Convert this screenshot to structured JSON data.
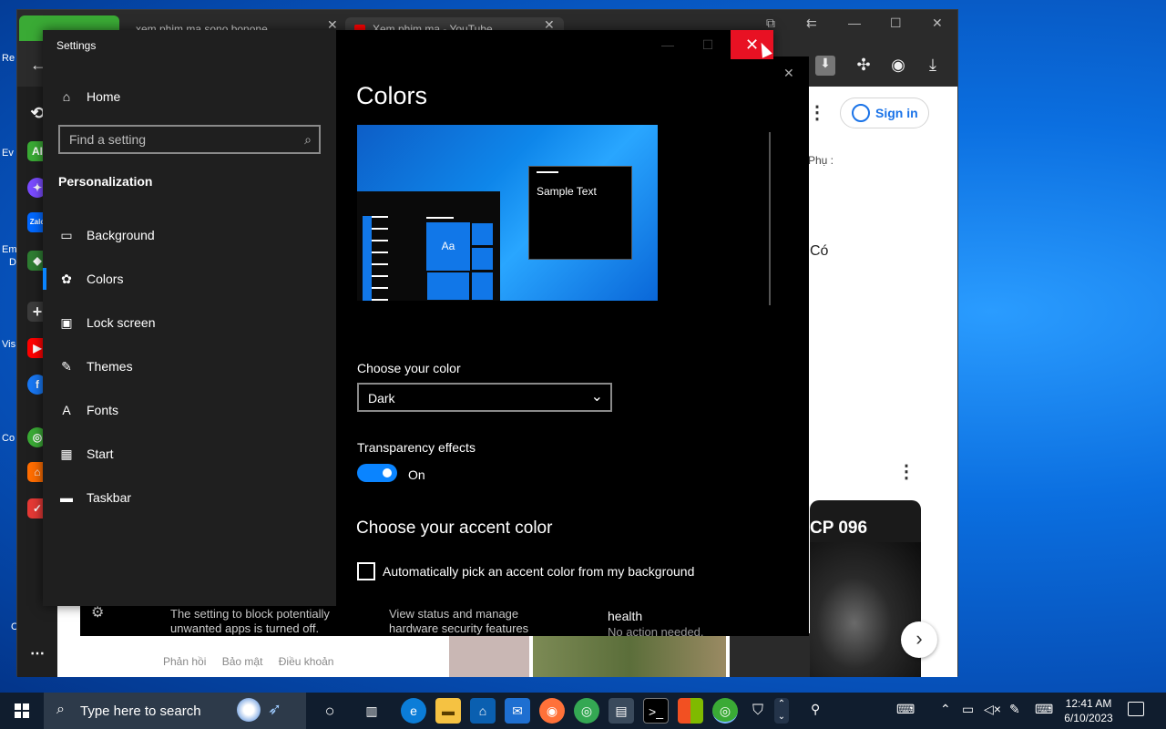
{
  "settings": {
    "window_title": "Settings",
    "close_glyph": "✕",
    "nav": {
      "home": "Home",
      "search_placeholder": "Find a setting",
      "section": "Personalization",
      "items": [
        {
          "label": "Background",
          "icon": "picture-icon"
        },
        {
          "label": "Colors",
          "icon": "palette-icon"
        },
        {
          "label": "Lock screen",
          "icon": "lock-screen-icon"
        },
        {
          "label": "Themes",
          "icon": "brush-icon"
        },
        {
          "label": "Fonts",
          "icon": "font-icon"
        },
        {
          "label": "Start",
          "icon": "start-icon"
        },
        {
          "label": "Taskbar",
          "icon": "taskbar-icon"
        }
      ],
      "active_item": "Colors"
    },
    "page": {
      "title": "Colors",
      "preview_sample_text": "Sample Text",
      "preview_tile_text": "Aa",
      "choose_color_label": "Choose your color",
      "choose_color_value": "Dark",
      "transparency_label": "Transparency effects",
      "transparency_state": "On",
      "accent_heading": "Choose your accent color",
      "auto_accent_label": "Automatically pick an accent color from my background",
      "auto_accent_checked": false
    }
  },
  "security_strip": {
    "item1": "The setting to block potentially unwanted apps is turned off.",
    "item2": "View status and manage hardware security features",
    "item3_title": "health",
    "item3_sub": "No action needed."
  },
  "browser": {
    "tab1_title": "xem phim ma sono bonone",
    "tab2_title": "Xem phim ma - YouTube",
    "signin_label": "Sign in",
    "side_text_1": "Phụ :",
    "side_text_2": "Có",
    "video_title": "CP 096",
    "footer_links": [
      "Phản hồi",
      "Bảo mật",
      "Điều khoản"
    ]
  },
  "desktop_labels": [
    "Re",
    "Ev",
    "Em",
    "D",
    "Vis",
    "Co",
    "C"
  ],
  "taskbar": {
    "search_placeholder": "Type here to search",
    "time": "12:41 AM",
    "date": "6/10/2023"
  },
  "colors": {
    "accent": "#0a84ff",
    "close_red": "#e81123",
    "settings_bg": "#000000",
    "nav_bg": "#1f1f1f"
  }
}
